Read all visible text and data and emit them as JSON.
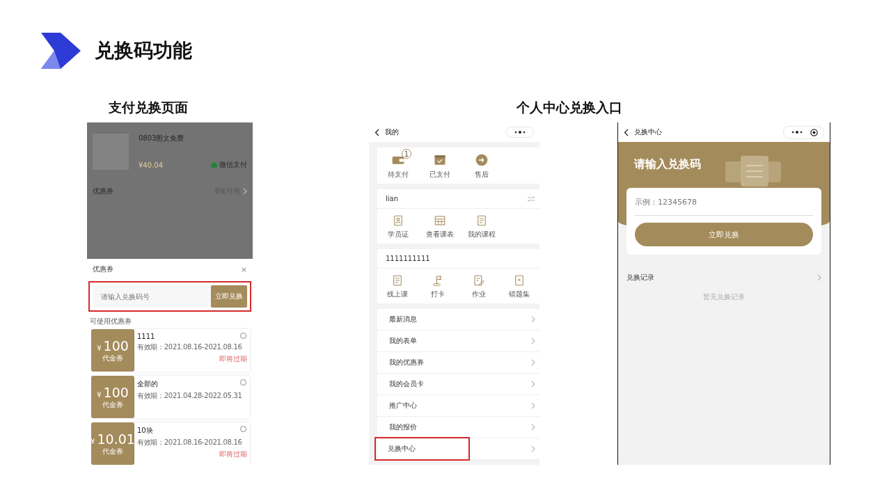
{
  "slide": {
    "title": "兑换码功能"
  },
  "headings": [
    {
      "text": "支付兑换页面"
    },
    {
      "text": "个人中心兑换入口"
    }
  ],
  "payment_screen": {
    "order": {
      "title": "0803图文免费",
      "price": "¥40.04",
      "payment": "微信支付"
    },
    "coupon_row": {
      "label": "优惠券",
      "value": "8张可用"
    },
    "sheet": {
      "title": "优惠券",
      "close": "×",
      "redeem": {
        "placeholder": "请输入兑换码号",
        "button": "立即兑换",
        "highlighted": true
      },
      "section_label": "可使用优惠券",
      "coupons": [
        {
          "currency": "¥",
          "amount": "100",
          "type": "代金券",
          "name": "1111",
          "validity": "有效期：2021.08.16-2021.08.16",
          "tag": "即将过期",
          "selected": false
        },
        {
          "currency": "¥",
          "amount": "100",
          "type": "代金券",
          "name": "全部的",
          "validity": "有效期：2021.04.28-2022.05.31",
          "selected": false
        },
        {
          "currency": "¥",
          "amount": "10.01",
          "type": "代金券",
          "name": "10块",
          "validity": "有效期：2021.08.16-2021.08.16",
          "tag": "即将过期",
          "selected": false
        }
      ]
    }
  },
  "profile_screen": {
    "nav_title": "我的",
    "orders": [
      {
        "label": "待支付",
        "badge": "1"
      },
      {
        "label": "已支付"
      },
      {
        "label": "售后"
      }
    ],
    "account": {
      "name": "lian",
      "items": [
        {
          "label": "学员证"
        },
        {
          "label": "查看课表"
        },
        {
          "label": "我的课程"
        }
      ]
    },
    "class_card": {
      "name": "1111111111",
      "items": [
        {
          "label": "线上课"
        },
        {
          "label": "打卡"
        },
        {
          "label": "作业"
        },
        {
          "label": "错题集"
        }
      ]
    },
    "menu": [
      {
        "label": "最新消息",
        "highlighted": false
      },
      {
        "label": "我的表单",
        "highlighted": false
      },
      {
        "label": "我的优惠券",
        "highlighted": false
      },
      {
        "label": "我的会员卡",
        "highlighted": false
      },
      {
        "label": "推广中心",
        "highlighted": false
      },
      {
        "label": "我的报价",
        "highlighted": false
      },
      {
        "label": "兑换中心",
        "highlighted": true
      }
    ]
  },
  "redeem_screen": {
    "nav_title": "兑换中心",
    "banner_title": "请输入兑换码",
    "placeholder": "示例：12345678",
    "button": "立即兑换",
    "records_label": "兑换记录",
    "empty_text": "暂无兑换记录"
  }
}
